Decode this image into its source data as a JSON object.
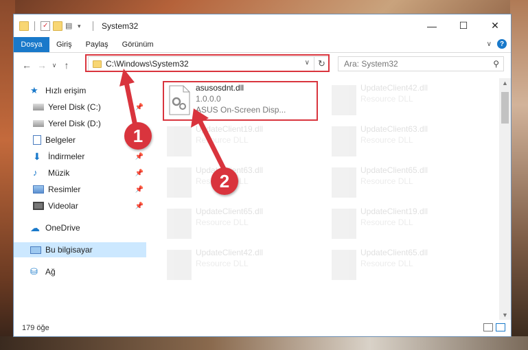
{
  "window": {
    "title": "System32",
    "controls": {
      "minimize": "—",
      "maximize": "☐",
      "close": "✕"
    }
  },
  "ribbon": {
    "tabs": [
      "Dosya",
      "Giriş",
      "Paylaş",
      "Görünüm"
    ],
    "accent": "#1979ca"
  },
  "address": {
    "path": "C:\\Windows\\System32",
    "search_placeholder": "Ara: System32"
  },
  "sidebar": {
    "items": [
      {
        "label": "Hızlı erişim",
        "icon": "star-icon",
        "pinned": false
      },
      {
        "label": "Yerel Disk (C:)",
        "icon": "drive-icon",
        "pinned": true
      },
      {
        "label": "Yerel Disk (D:)",
        "icon": "drive-icon",
        "pinned": false
      },
      {
        "label": "Belgeler",
        "icon": "documents-icon",
        "pinned": true
      },
      {
        "label": "İndirmeler",
        "icon": "download-icon",
        "pinned": true
      },
      {
        "label": "Müzik",
        "icon": "music-icon",
        "pinned": true
      },
      {
        "label": "Resimler",
        "icon": "pictures-icon",
        "pinned": true
      },
      {
        "label": "Videolar",
        "icon": "videos-icon",
        "pinned": true
      },
      {
        "label": "OneDrive",
        "icon": "onedrive-icon",
        "pinned": false
      },
      {
        "label": "Bu bilgisayar",
        "icon": "computer-icon",
        "pinned": false,
        "selected": true
      },
      {
        "label": "Ağ",
        "icon": "network-icon",
        "pinned": false
      }
    ]
  },
  "files": {
    "highlighted": {
      "name": "asusosdnt.dll",
      "version": "1.0.0.0",
      "description": "ASUS On-Screen Disp..."
    },
    "faded": [
      {
        "name": "UpdateClient42.dll",
        "description": "Resource DLL"
      },
      {
        "name": "UpdateClient19.dll",
        "description": "Resource DLL"
      },
      {
        "name": "UpdateClient63.dll",
        "description": "Resource DLL"
      },
      {
        "name": "UpdateClient63.dll",
        "description": "Resource DLL"
      },
      {
        "name": "UpdateClient65.dll",
        "description": "Resource DLL"
      },
      {
        "name": "UpdateClient65.dll",
        "description": "Resource DLL"
      },
      {
        "name": "UpdateClient19.dll",
        "description": "Resource DLL"
      },
      {
        "name": "UpdateClient42.dll",
        "description": "Resource DLL"
      },
      {
        "name": "UpdateClient65.dll",
        "description": "Resource DLL"
      }
    ]
  },
  "status": {
    "item_count": "179 öğe"
  },
  "callouts": {
    "first": "1",
    "second": "2",
    "color": "#d9343d"
  }
}
